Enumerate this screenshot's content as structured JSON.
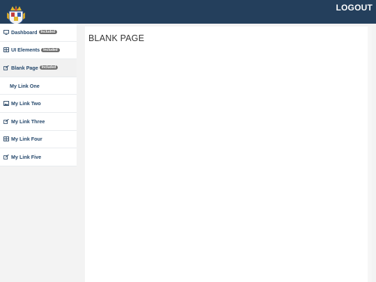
{
  "header": {
    "logout_label": "LOGOUT"
  },
  "sidebar": {
    "items": [
      {
        "label": "Dashboard",
        "badge": "Included",
        "icon": "desktop-icon"
      },
      {
        "label": "UI Elements",
        "badge": "Included",
        "icon": "table-icon"
      },
      {
        "label": "Blank Page",
        "badge": "Included",
        "icon": "edit-icon",
        "active": true
      },
      {
        "label": "My Link One",
        "badge": "",
        "icon": "none"
      },
      {
        "label": "My Link Two",
        "badge": "",
        "icon": "image-icon"
      },
      {
        "label": "My Link Three",
        "badge": "",
        "icon": "edit-icon"
      },
      {
        "label": "My Link Four",
        "badge": "",
        "icon": "table-icon"
      },
      {
        "label": "My Link Five",
        "badge": "",
        "icon": "edit-icon"
      }
    ]
  },
  "main": {
    "title": "BLANK PAGE"
  },
  "colors": {
    "header_bg": "#243f5c",
    "link_text": "#24476b",
    "badge_bg": "#6f6f6f"
  }
}
